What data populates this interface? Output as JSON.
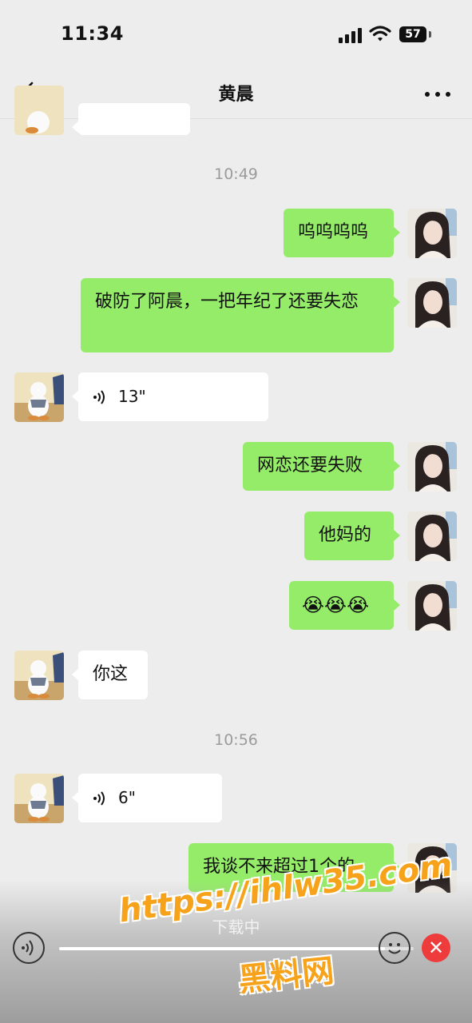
{
  "status_bar": {
    "time": "11:34",
    "battery": "57"
  },
  "nav": {
    "title": "黄晨"
  },
  "chat": {
    "timestamps": [
      "10:49",
      "10:56"
    ],
    "messages": [
      {
        "side": "left",
        "type": "text",
        "text": "",
        "partial": true
      },
      {
        "side": "right",
        "type": "text",
        "text": "呜呜呜呜"
      },
      {
        "side": "right",
        "type": "text",
        "text": "破防了阿晨，一把年纪了还要失恋"
      },
      {
        "side": "left",
        "type": "voice",
        "duration": "13\""
      },
      {
        "side": "right",
        "type": "text",
        "text": "网恋还要失败"
      },
      {
        "side": "right",
        "type": "text",
        "text": "他妈的"
      },
      {
        "side": "right",
        "type": "text",
        "text": "😭😭😭"
      },
      {
        "side": "left",
        "type": "text",
        "text": "你这"
      },
      {
        "side": "left",
        "type": "voice",
        "duration": "6\""
      },
      {
        "side": "right",
        "type": "text",
        "text": "我谈不来超过1个的"
      }
    ]
  },
  "download": {
    "label": "下载中",
    "progress": 0.92
  },
  "watermark": {
    "url": "https://ihlw35.com",
    "name": "黑料网"
  },
  "colors": {
    "outgoing": "#95ec69",
    "incoming": "#ffffff",
    "background": "#ededed",
    "close": "#ee3b3b",
    "watermark": "#f7a21b"
  }
}
